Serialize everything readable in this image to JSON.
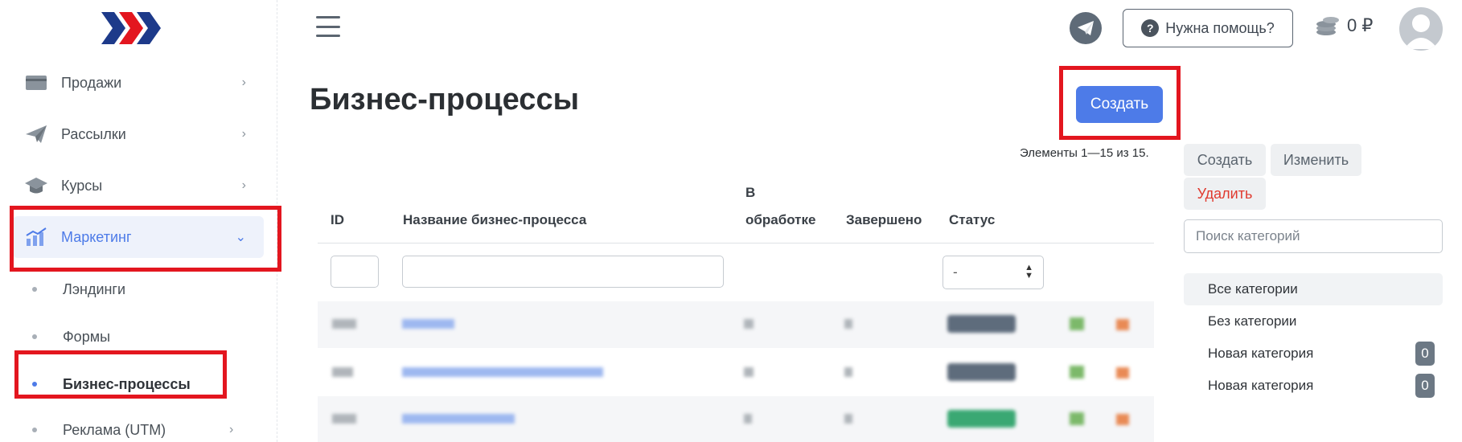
{
  "sidebar": {
    "items": [
      {
        "label": "Продажи",
        "icon": "card-icon"
      },
      {
        "label": "Рассылки",
        "icon": "paper-plane-icon"
      },
      {
        "label": "Курсы",
        "icon": "graduation-cap-icon"
      },
      {
        "label": "Маркетинг",
        "icon": "chart-icon"
      }
    ],
    "subitems": [
      {
        "label": "Лэндинги"
      },
      {
        "label": "Формы"
      },
      {
        "label": "Бизнес-процессы"
      },
      {
        "label": "Реклама (UTM)"
      }
    ]
  },
  "header": {
    "help_label": "Нужна помощь?",
    "help_icon": "?",
    "balance": "0 ₽"
  },
  "main": {
    "title": "Бизнес-процессы",
    "create_label": "Создать",
    "elements_info": "Элементы 1—15 из 15.",
    "columns": {
      "id": "ID",
      "name": "Название бизнес-процесса",
      "in_progress_1": "В",
      "in_progress_2": "обработке",
      "done": "Завершено",
      "status": "Статус"
    },
    "status_filter": "-"
  },
  "right_panel": {
    "create_label": "Создать",
    "edit_label": "Изменить",
    "delete_label": "Удалить",
    "search_placeholder": "Поиск категорий",
    "categories": [
      {
        "label": "Все категории"
      },
      {
        "label": "Без категории"
      },
      {
        "label": "Новая категория",
        "count": "0"
      },
      {
        "label": "Новая категория",
        "count": "0"
      }
    ]
  },
  "colors": {
    "accent": "#4d7be8",
    "highlight": "#e3161f",
    "danger": "#e03a2f"
  }
}
